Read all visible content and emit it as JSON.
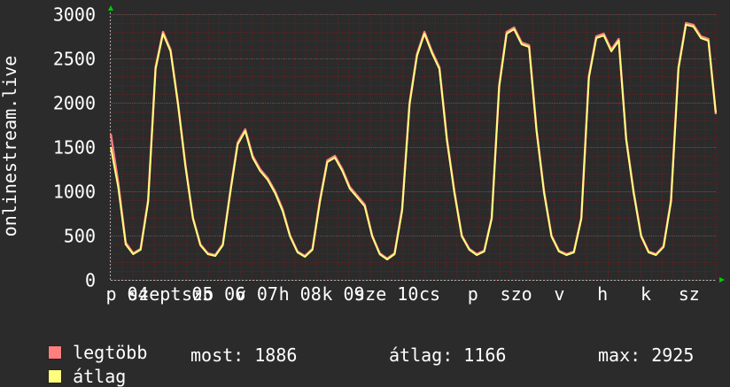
{
  "chart_data": {
    "type": "line",
    "ylabel": "onlinestream.live",
    "ylim": [
      0,
      3000
    ],
    "yticks": [
      0,
      500,
      1000,
      1500,
      2000,
      2500,
      3000
    ],
    "xtick_labels": [
      "p 04",
      "szept 05",
      "szo 06",
      "v 07",
      "h 08",
      "k 09",
      "sze 10",
      "cs",
      "p",
      "szo",
      "v",
      "h",
      "k",
      "sz"
    ],
    "x_days": [
      0,
      1,
      2,
      3,
      4,
      5,
      6
    ],
    "grid": true,
    "series": [
      {
        "name": "legtöbb",
        "color": "#ff7f7f",
        "values": [
          1650,
          1100,
          420,
          300,
          350,
          900,
          2400,
          2800,
          2600,
          2000,
          1300,
          700,
          400,
          300,
          280,
          400,
          1000,
          1550,
          1700,
          1400,
          1250,
          1150,
          1000,
          800,
          500,
          320,
          270,
          350,
          900,
          1350,
          1400,
          1250,
          1050,
          950,
          850,
          500,
          300,
          240,
          300,
          800,
          2000,
          2550,
          2800,
          2580,
          2400,
          1600,
          1000,
          500,
          350,
          290,
          330,
          700,
          2200,
          2800,
          2850,
          2680,
          2650,
          1700,
          1000,
          500,
          330,
          290,
          320,
          700,
          2300,
          2750,
          2780,
          2600,
          2720,
          1600,
          1000,
          500,
          320,
          290,
          380,
          900,
          2400,
          2900,
          2880,
          2750,
          2720,
          1870
        ]
      },
      {
        "name": "átlag",
        "color": "#ffff7f",
        "values": [
          1500,
          1050,
          400,
          290,
          340,
          880,
          2380,
          2780,
          2580,
          1980,
          1280,
          690,
          390,
          290,
          270,
          390,
          980,
          1530,
          1680,
          1380,
          1230,
          1130,
          980,
          780,
          490,
          310,
          260,
          340,
          880,
          1330,
          1380,
          1230,
          1030,
          930,
          830,
          490,
          290,
          230,
          290,
          780,
          1980,
          2530,
          2780,
          2560,
          2380,
          1580,
          980,
          490,
          340,
          280,
          320,
          690,
          2180,
          2780,
          2830,
          2660,
          2630,
          1680,
          980,
          490,
          320,
          280,
          310,
          690,
          2280,
          2730,
          2760,
          2580,
          2700,
          1580,
          980,
          490,
          310,
          280,
          370,
          880,
          2380,
          2880,
          2860,
          2730,
          2700,
          1886
        ]
      }
    ]
  },
  "legend": {
    "max_label": "legtöbb",
    "avg_label": "átlag",
    "current": "most: 1886",
    "average": "átlag: 1166",
    "maximum": "max: 2925"
  },
  "colors": {
    "background": "#2b2b2b",
    "plot_background": "#2b2b2b",
    "grid_minor": "#8b1a1a",
    "grid_major": "#555555",
    "axis": "#ffffff",
    "arrow": "#00cc00"
  }
}
